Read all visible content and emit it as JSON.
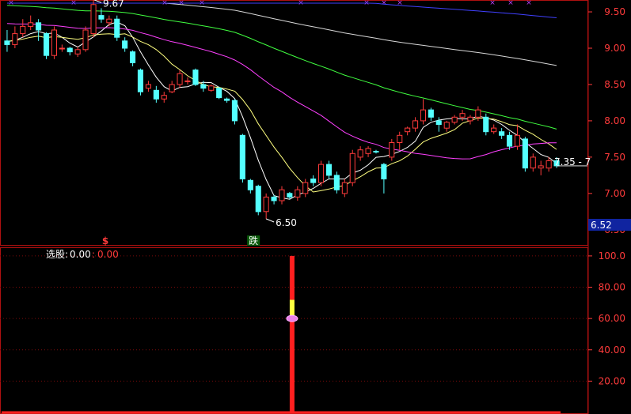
{
  "chart_data": [
    {
      "type": "candlestick",
      "colors": {
        "up": "#ff3b3b",
        "down": "#54ffff",
        "ma5": "#ffffff",
        "ma10": "#ffff80",
        "ma30": "#ff40ff",
        "ma60": "#40ff40",
        "ma120": "#d8d8d8",
        "ma250": "#4040ff"
      },
      "ylim": [
        6.4,
        9.62
      ],
      "y_ticks": [
        "9.50",
        "9.00",
        "8.50",
        "8.00",
        "7.50",
        "7.00",
        "6.50"
      ],
      "last_price_tag": "6.52",
      "annotations": {
        "high": "9.67",
        "low": "6.50",
        "last": "7.35 - 7",
        "low_marker": "跌",
        "signal_marker": "$"
      },
      "candles": [
        [
          9.1,
          9.25,
          8.95,
          9.05
        ],
        [
          9.05,
          9.3,
          9.0,
          9.2
        ],
        [
          9.2,
          9.4,
          9.15,
          9.3
        ],
        [
          9.3,
          9.45,
          9.25,
          9.35
        ],
        [
          9.35,
          9.4,
          9.1,
          9.25
        ],
        [
          9.2,
          9.22,
          8.85,
          8.9
        ],
        [
          8.9,
          9.3,
          8.85,
          9.25
        ],
        [
          9.0,
          9.05,
          8.95,
          9.0
        ],
        [
          9.0,
          9.02,
          8.9,
          8.95
        ],
        [
          8.92,
          9.02,
          8.88,
          8.98
        ],
        [
          8.98,
          9.3,
          8.95,
          9.25
        ],
        [
          9.2,
          9.67,
          9.15,
          9.6
        ],
        [
          9.45,
          9.55,
          9.35,
          9.4
        ],
        [
          9.35,
          9.45,
          9.3,
          9.4
        ],
        [
          9.4,
          9.45,
          9.1,
          9.15
        ],
        [
          9.1,
          9.15,
          8.95,
          9.0
        ],
        [
          8.95,
          8.97,
          8.75,
          8.8
        ],
        [
          8.7,
          8.72,
          8.35,
          8.4
        ],
        [
          8.45,
          8.55,
          8.4,
          8.5
        ],
        [
          8.42,
          8.48,
          8.25,
          8.3
        ],
        [
          8.3,
          8.4,
          8.25,
          8.35
        ],
        [
          8.4,
          8.55,
          8.38,
          8.5
        ],
        [
          8.5,
          8.7,
          8.45,
          8.65
        ],
        [
          8.55,
          8.6,
          8.5,
          8.55
        ],
        [
          8.7,
          8.72,
          8.48,
          8.5
        ],
        [
          8.5,
          8.55,
          8.4,
          8.45
        ],
        [
          8.42,
          8.5,
          8.4,
          8.48
        ],
        [
          8.45,
          8.47,
          8.3,
          8.32
        ],
        [
          8.3,
          8.32,
          8.25,
          8.28
        ],
        [
          8.28,
          8.3,
          7.95,
          8.0
        ],
        [
          7.8,
          7.82,
          7.15,
          7.2
        ],
        [
          7.18,
          7.2,
          7.0,
          7.05
        ],
        [
          7.1,
          7.12,
          6.7,
          6.75
        ],
        [
          6.75,
          7.0,
          6.65,
          6.95
        ],
        [
          6.95,
          6.98,
          6.85,
          6.9
        ],
        [
          6.9,
          7.1,
          6.85,
          7.05
        ],
        [
          7.0,
          7.02,
          6.92,
          6.95
        ],
        [
          6.95,
          7.1,
          6.9,
          7.05
        ],
        [
          7.0,
          7.2,
          6.95,
          7.15
        ],
        [
          7.2,
          7.25,
          7.1,
          7.15
        ],
        [
          7.15,
          7.45,
          7.1,
          7.4
        ],
        [
          7.4,
          7.45,
          7.2,
          7.25
        ],
        [
          7.25,
          7.3,
          7.0,
          7.05
        ],
        [
          7.0,
          7.2,
          6.95,
          7.15
        ],
        [
          7.15,
          7.6,
          7.1,
          7.55
        ],
        [
          7.5,
          7.65,
          7.45,
          7.6
        ],
        [
          7.55,
          7.65,
          7.5,
          7.62
        ],
        [
          7.58,
          7.6,
          7.55,
          7.57
        ],
        [
          7.4,
          7.42,
          7.0,
          7.2
        ],
        [
          7.5,
          7.75,
          7.45,
          7.7
        ],
        [
          7.7,
          7.85,
          7.6,
          7.8
        ],
        [
          7.85,
          7.92,
          7.8,
          7.9
        ],
        [
          7.9,
          8.05,
          7.85,
          8.0
        ],
        [
          8.0,
          8.3,
          7.95,
          8.15
        ],
        [
          8.15,
          8.18,
          8.0,
          8.05
        ],
        [
          8.0,
          8.05,
          7.85,
          7.95
        ],
        [
          7.9,
          8.0,
          7.85,
          7.98
        ],
        [
          7.98,
          8.08,
          7.95,
          8.05
        ],
        [
          8.05,
          8.15,
          8.0,
          8.1
        ],
        [
          8.0,
          8.08,
          7.95,
          8.05
        ],
        [
          8.05,
          8.2,
          8.0,
          8.15
        ],
        [
          8.05,
          8.1,
          7.8,
          7.85
        ],
        [
          7.85,
          7.95,
          7.82,
          7.9
        ],
        [
          7.85,
          7.9,
          7.75,
          7.8
        ],
        [
          7.8,
          7.85,
          7.6,
          7.65
        ],
        [
          7.65,
          7.95,
          7.6,
          7.8
        ],
        [
          7.75,
          7.78,
          7.3,
          7.35
        ],
        [
          7.35,
          7.55,
          7.3,
          7.5
        ],
        [
          7.35,
          7.45,
          7.25,
          7.38
        ],
        [
          7.35,
          7.5,
          7.3,
          7.45
        ],
        [
          7.45,
          7.5,
          7.35,
          7.38
        ]
      ]
    },
    {
      "type": "bar",
      "title": "选股",
      "legend_values": [
        "0.00",
        "0.00"
      ],
      "y_ticks": [
        "100.0",
        "80.00",
        "60.00",
        "40.00",
        "20.00"
      ],
      "ylim": [
        0,
        105
      ],
      "signal": {
        "candle_index": 36,
        "value": 100,
        "segments": [
          [
            0,
            60,
            "#ff1f1f"
          ],
          [
            60,
            72,
            "#ffff40"
          ],
          [
            72,
            80,
            "#ff1f1f"
          ],
          [
            80,
            100,
            "#ff1f1f"
          ]
        ]
      }
    }
  ]
}
